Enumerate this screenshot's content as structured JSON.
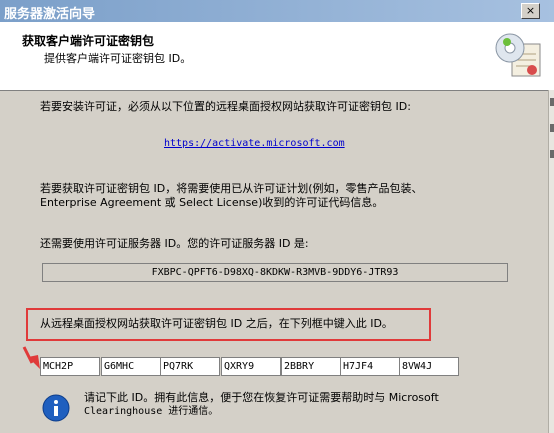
{
  "window": {
    "title": "服务器激活向导",
    "close_label": "×"
  },
  "header": {
    "title": "获取客户端许可证密钥包",
    "subtitle": "提供客户端许可证密钥包 ID。"
  },
  "content": {
    "intro": "若要安装许可证，必须从以下位置的远程桌面授权网站获取许可证密钥包 ID:",
    "url": "https://activate.microsoft.com",
    "program_line1": "若要获取许可证密钥包 ID，将需要使用已从许可证计划(例如，零售产品包装、",
    "program_line2": "Enterprise Agreement 或 Select License)收到的许可证代码信息。",
    "server_id_label": "还需要使用许可证服务器 ID。您的许可证服务器 ID 是:",
    "server_id": "FXBPC-QPFT6-D98XQ-8KDKW-R3MVB-9DDY6-JTR93",
    "enter_instruction": "从远程桌面授权网站获取许可证密钥包 ID 之后，在下列框中键入此 ID。",
    "key_fields": [
      "MCH2P",
      "G6MHC",
      "PQ7RK",
      "QXRY9",
      "2BBRY",
      "H7JF4",
      "8VW4J"
    ],
    "info_line1": "请记下此 ID。拥有此信息，便于您在恢复许可证需要帮助时与 Microsoft",
    "info_line2": "Clearinghouse 进行通信。"
  },
  "icons": {
    "header": "certificate-disc-icon",
    "info": "info-icon",
    "annotation": "red-arrow-icon"
  },
  "colors": {
    "highlight_box": "#e03a3a",
    "link": "#0000cc",
    "info_blue": "#1f5fbf"
  }
}
